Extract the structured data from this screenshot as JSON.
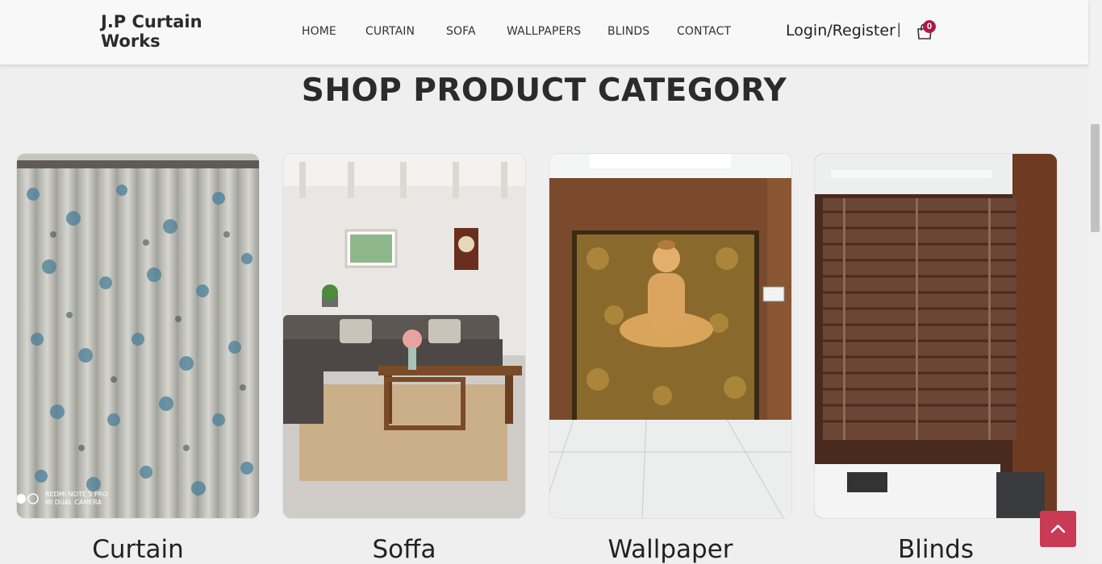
{
  "brand": {
    "name": "J.P Curtain Works"
  },
  "nav": {
    "items": [
      {
        "label": "HOME"
      },
      {
        "label": "CURTAIN"
      },
      {
        "label": "SOFA"
      },
      {
        "label": "WALLPAPERS"
      },
      {
        "label": "BLINDS"
      },
      {
        "label": "CONTACT"
      }
    ],
    "login_label": "Login/Register",
    "separator": "|",
    "cart_count": "0",
    "cart_icon": "shopping-bag-icon"
  },
  "section": {
    "title": "SHOP PRODUCT CATEGORY"
  },
  "categories": [
    {
      "label": "Curtain",
      "watermark_line1": "REDMI NOTE 5 PRO",
      "watermark_line2": "MI DUAL CAMERA"
    },
    {
      "label": "Soffa"
    },
    {
      "label": "Wallpaper"
    },
    {
      "label": "Blinds"
    }
  ],
  "colors": {
    "badge": "#b0174c",
    "scroll_top_button": "#c93a55"
  },
  "scroll_top_icon": "chevron-up-icon"
}
